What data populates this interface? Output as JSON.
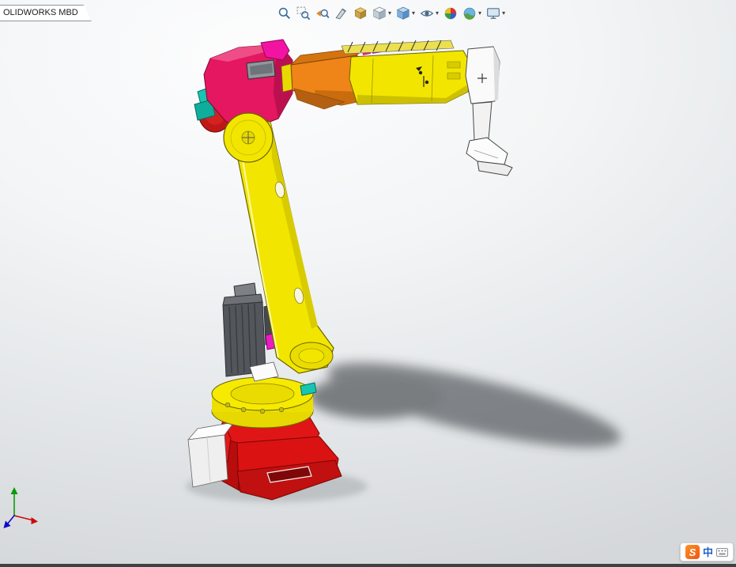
{
  "window": {
    "tab_label": "OLIDWORKS MBD"
  },
  "toolbar": {
    "caret": "▾",
    "buttons": [
      {
        "id": "zoom-to-fit"
      },
      {
        "id": "zoom-to-area"
      },
      {
        "id": "previous-view"
      },
      {
        "id": "section-view"
      },
      {
        "id": "dynamic-annotation-views"
      },
      {
        "id": "view-orientation",
        "caret": true
      },
      {
        "id": "display-style",
        "caret": true
      },
      {
        "id": "hide-show-items",
        "caret": true
      },
      {
        "id": "edit-appearance"
      },
      {
        "id": "apply-scene",
        "caret": true
      },
      {
        "id": "view-settings",
        "caret": true
      }
    ]
  },
  "ime": {
    "logo_letter": "S",
    "lang_indicator": "中"
  },
  "colors": {
    "robot_yellow": "#f2e600",
    "robot_yellow_dark": "#cfc400",
    "robot_red": "#da1212",
    "robot_red_dark": "#b20c0c",
    "robot_pink": "#e41760",
    "robot_magenta": "#f313a2",
    "robot_orange": "#ef8418",
    "robot_teal": "#17c6b2",
    "robot_gray": "#53575b",
    "robot_white": "#fafafa",
    "shadow": "#2e3338",
    "viewport_top": "#fdfdfe",
    "viewport_bottom": "#d5d8da"
  }
}
